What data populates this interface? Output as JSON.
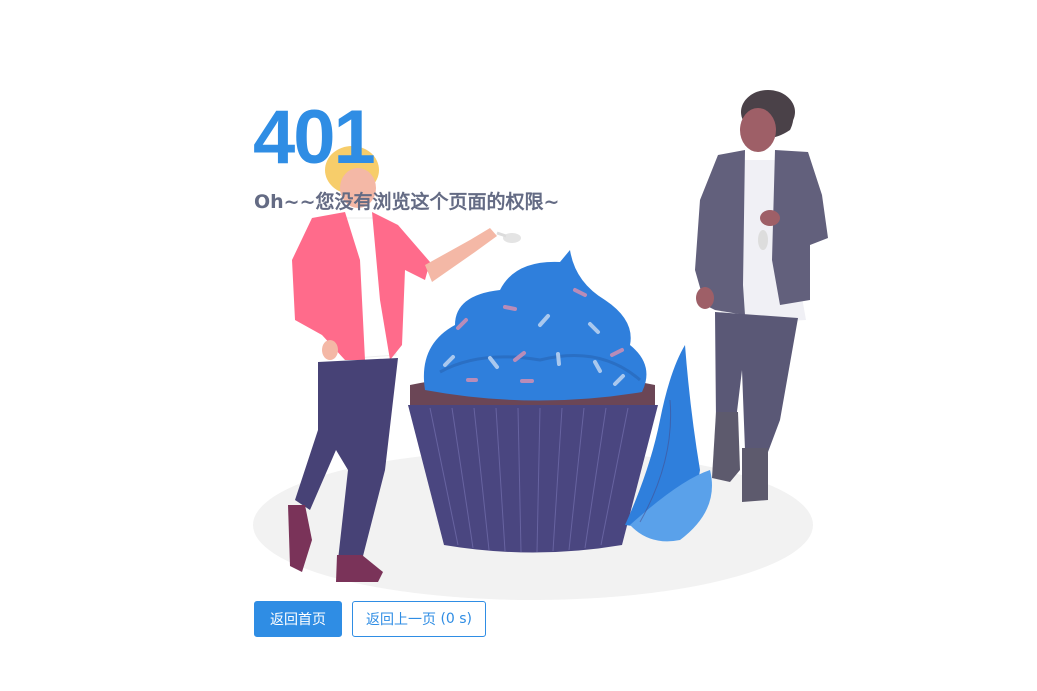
{
  "error": {
    "code": "401",
    "message": "Oh~~您没有浏览这个页面的权限~"
  },
  "actions": {
    "home_label": "返回首页",
    "back_label": "返回上一页",
    "countdown": "(0 s)"
  },
  "colors": {
    "accent": "#2f8de4",
    "message": "#646b84",
    "frosting": "#2f7fdc",
    "cup": "#4a4680",
    "jacket": "#ff6b8b"
  },
  "illustration": "cupcake-people-illustration"
}
